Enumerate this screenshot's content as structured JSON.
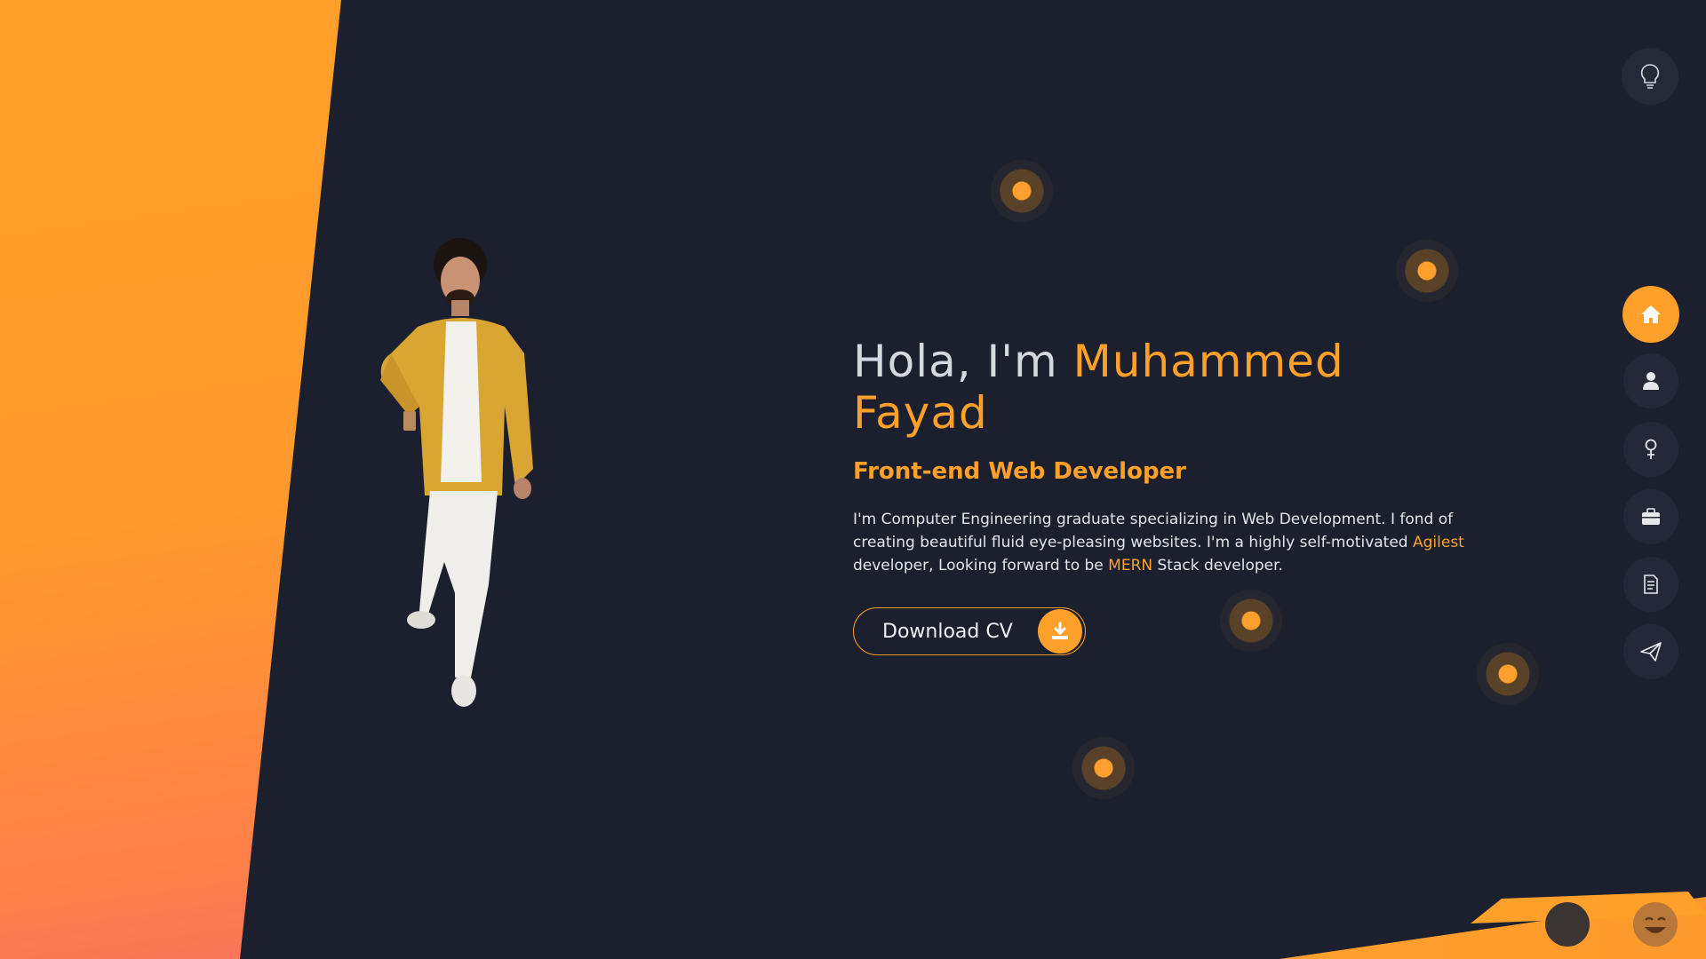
{
  "hero": {
    "greeting": "Hola, I'm ",
    "name": "Muhammed Fayad",
    "role": "Front-end Web Developer",
    "bio_part1": "I'm Computer Engineering graduate specializing in Web Development. I fond of creating beautiful fluid eye-pleasing websites. I'm a highly self-motivated ",
    "bio_highlight1": "Agilest",
    "bio_part2": " developer, Looking forward to be ",
    "bio_highlight2": "MERN",
    "bio_part3": " Stack developer.",
    "download_label": "Download CV"
  },
  "nav": {
    "items": [
      {
        "name": "home",
        "icon": "home-icon",
        "active": true
      },
      {
        "name": "about",
        "icon": "user-icon",
        "active": false
      },
      {
        "name": "skills",
        "icon": "pin-icon",
        "active": false
      },
      {
        "name": "portfolio",
        "icon": "briefcase-icon",
        "active": false
      },
      {
        "name": "resume",
        "icon": "document-icon",
        "active": false
      },
      {
        "name": "contact",
        "icon": "send-icon",
        "active": false
      }
    ]
  },
  "theme_toggle": {
    "icon": "lightbulb-icon"
  },
  "colors": {
    "accent": "#ffa02a",
    "background": "#1b1f2e",
    "nav_bg": "#242838"
  }
}
